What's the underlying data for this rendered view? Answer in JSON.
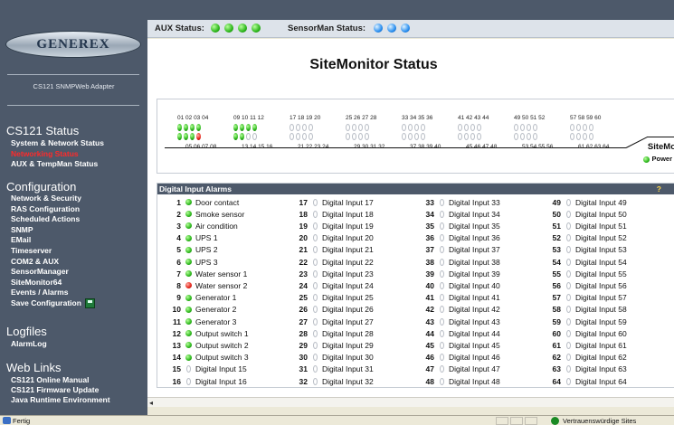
{
  "sidebar": {
    "logo": "GENEREX",
    "adapter": "CS121 SNMPWeb Adapter",
    "sections": [
      {
        "title": "CS121 Status",
        "items": [
          "System & Network Status",
          "Networking Status",
          "AUX & TempMan Status"
        ]
      },
      {
        "title": "Configuration",
        "items": [
          "Network & Security",
          "RAS Configuration",
          "Scheduled Actions",
          "SNMP",
          "EMail",
          "Timeserver",
          "COM2 & AUX",
          "SensorManager",
          "SiteMonitor64",
          "Events / Alarms",
          "Save Configuration"
        ]
      },
      {
        "title": "Logfiles",
        "items": [
          "AlarmLog"
        ]
      },
      {
        "title": "Web Links",
        "items": [
          "CS121 Online Manual",
          "CS121 Firmware Update",
          "Java Runtime Environment"
        ]
      }
    ],
    "active_item": "Networking Status"
  },
  "topbar": {
    "aux_label": "AUX Status:",
    "aux_leds": [
      "green",
      "green",
      "green",
      "green"
    ],
    "sensor_label": "SensorMan Status:",
    "sensor_leds": [
      "blue",
      "blue",
      "blue"
    ]
  },
  "main": {
    "title": "SiteMonitor Status",
    "sitemonitor": {
      "name": "SiteMo",
      "power_label": "Power",
      "top_numbers": [
        "01 02 03 04",
        "09 10 11 12",
        "17 18 19 20",
        "25 26 27 28",
        "33 34 35 36",
        "41 42 43 44",
        "49 50 51 52",
        "57 58 59 60"
      ],
      "bottom_numbers": [
        "05 06 07 08",
        "13 14 15 16",
        "21 22 23 24",
        "29 30 31 32",
        "37 38 39 40",
        "45 46 47 48",
        "53 54 55 56",
        "61 62 63 64"
      ]
    },
    "alarms": {
      "header": "Digital Input Alarms",
      "help": "?",
      "rows": [
        {
          "n": "1",
          "state": "green",
          "label": "Door contact"
        },
        {
          "n": "2",
          "state": "green",
          "label": "Smoke sensor"
        },
        {
          "n": "3",
          "state": "green",
          "label": "Air condition"
        },
        {
          "n": "4",
          "state": "green",
          "label": "UPS 1"
        },
        {
          "n": "5",
          "state": "green",
          "label": "UPS 2"
        },
        {
          "n": "6",
          "state": "green",
          "label": "UPS 3"
        },
        {
          "n": "7",
          "state": "green",
          "label": "Water sensor 1"
        },
        {
          "n": "8",
          "state": "red",
          "label": "Water sensor 2"
        },
        {
          "n": "9",
          "state": "green",
          "label": "Generator 1"
        },
        {
          "n": "10",
          "state": "green",
          "label": "Generator 2"
        },
        {
          "n": "11",
          "state": "green",
          "label": "Generator 3"
        },
        {
          "n": "12",
          "state": "green",
          "label": "Output switch 1"
        },
        {
          "n": "13",
          "state": "green",
          "label": "Output switch 2"
        },
        {
          "n": "14",
          "state": "green",
          "label": "Output switch 3"
        },
        {
          "n": "15",
          "state": "off",
          "label": "Digital Input 15"
        },
        {
          "n": "16",
          "state": "off",
          "label": "Digital Input 16"
        },
        {
          "n": "17",
          "state": "off",
          "label": "Digital Input 17"
        },
        {
          "n": "18",
          "state": "off",
          "label": "Digital Input 18"
        },
        {
          "n": "19",
          "state": "off",
          "label": "Digital Input 19"
        },
        {
          "n": "20",
          "state": "off",
          "label": "Digital Input 20"
        },
        {
          "n": "21",
          "state": "off",
          "label": "Digital Input 21"
        },
        {
          "n": "22",
          "state": "off",
          "label": "Digital Input 22"
        },
        {
          "n": "23",
          "state": "off",
          "label": "Digital Input 23"
        },
        {
          "n": "24",
          "state": "off",
          "label": "Digital Input 24"
        },
        {
          "n": "25",
          "state": "off",
          "label": "Digital Input 25"
        },
        {
          "n": "26",
          "state": "off",
          "label": "Digital Input 26"
        },
        {
          "n": "27",
          "state": "off",
          "label": "Digital Input 27"
        },
        {
          "n": "28",
          "state": "off",
          "label": "Digital Input 28"
        },
        {
          "n": "29",
          "state": "off",
          "label": "Digital Input 29"
        },
        {
          "n": "30",
          "state": "off",
          "label": "Digital Input 30"
        },
        {
          "n": "31",
          "state": "off",
          "label": "Digital Input 31"
        },
        {
          "n": "32",
          "state": "off",
          "label": "Digital Input 32"
        },
        {
          "n": "33",
          "state": "off",
          "label": "Digital Input 33"
        },
        {
          "n": "34",
          "state": "off",
          "label": "Digital Input 34"
        },
        {
          "n": "35",
          "state": "off",
          "label": "Digital Input 35"
        },
        {
          "n": "36",
          "state": "off",
          "label": "Digital Input 36"
        },
        {
          "n": "37",
          "state": "off",
          "label": "Digital Input 37"
        },
        {
          "n": "38",
          "state": "off",
          "label": "Digital Input 38"
        },
        {
          "n": "39",
          "state": "off",
          "label": "Digital Input 39"
        },
        {
          "n": "40",
          "state": "off",
          "label": "Digital Input 40"
        },
        {
          "n": "41",
          "state": "off",
          "label": "Digital Input 41"
        },
        {
          "n": "42",
          "state": "off",
          "label": "Digital Input 42"
        },
        {
          "n": "43",
          "state": "off",
          "label": "Digital Input 43"
        },
        {
          "n": "44",
          "state": "off",
          "label": "Digital Input 44"
        },
        {
          "n": "45",
          "state": "off",
          "label": "Digital Input 45"
        },
        {
          "n": "46",
          "state": "off",
          "label": "Digital Input 46"
        },
        {
          "n": "47",
          "state": "off",
          "label": "Digital Input 47"
        },
        {
          "n": "48",
          "state": "off",
          "label": "Digital Input 48"
        },
        {
          "n": "49",
          "state": "off",
          "label": "Digital Input 49"
        },
        {
          "n": "50",
          "state": "off",
          "label": "Digital Input 50"
        },
        {
          "n": "51",
          "state": "off",
          "label": "Digital Input 51"
        },
        {
          "n": "52",
          "state": "off",
          "label": "Digital Input 52"
        },
        {
          "n": "53",
          "state": "off",
          "label": "Digital Input 53"
        },
        {
          "n": "54",
          "state": "off",
          "label": "Digital Input 54"
        },
        {
          "n": "55",
          "state": "off",
          "label": "Digital Input 55"
        },
        {
          "n": "56",
          "state": "off",
          "label": "Digital Input 56"
        },
        {
          "n": "57",
          "state": "off",
          "label": "Digital Input 57"
        },
        {
          "n": "58",
          "state": "off",
          "label": "Digital Input 58"
        },
        {
          "n": "59",
          "state": "off",
          "label": "Digital Input 59"
        },
        {
          "n": "60",
          "state": "off",
          "label": "Digital Input 60"
        },
        {
          "n": "61",
          "state": "off",
          "label": "Digital Input 61"
        },
        {
          "n": "62",
          "state": "off",
          "label": "Digital Input 62"
        },
        {
          "n": "63",
          "state": "off",
          "label": "Digital Input 63"
        },
        {
          "n": "64",
          "state": "off",
          "label": "Digital Input 64"
        }
      ]
    }
  },
  "statusbar": {
    "left": "Fertig",
    "zone": "Vertrauenswürdige Sites"
  },
  "colors": {
    "sidebar": "#4d596a",
    "active_link": "#ff2a2a",
    "help": "#ffd84a"
  }
}
